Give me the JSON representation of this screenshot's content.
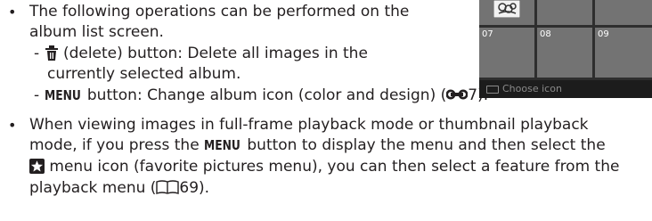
{
  "bullets": [
    {
      "lines": [
        "The following operations can be performed on the",
        "album list screen."
      ]
    },
    {
      "lines": [
        "When viewing images in full-frame playback mode or thumbnail playback",
        "mode, if you press the ",
        " button to display the menu and then select the",
        " menu icon (favorite pictures menu), you can then select a feature from the",
        "playback menu (",
        "69)."
      ]
    }
  ],
  "menu_label": "MENU",
  "sub_items": {
    "delete_a": " (delete) button: Delete all images in the",
    "delete_b": "currently selected album.",
    "menu_rest": " button: Change album icon (color and design) (",
    "menu_ref": "7)."
  },
  "screen": {
    "cells": [
      "07",
      "08",
      "09"
    ],
    "footer_text": "Choose icon"
  },
  "icon_names": [
    "trash-icon",
    "reference-link-icon",
    "favorite-star-icon",
    "book-icon"
  ]
}
